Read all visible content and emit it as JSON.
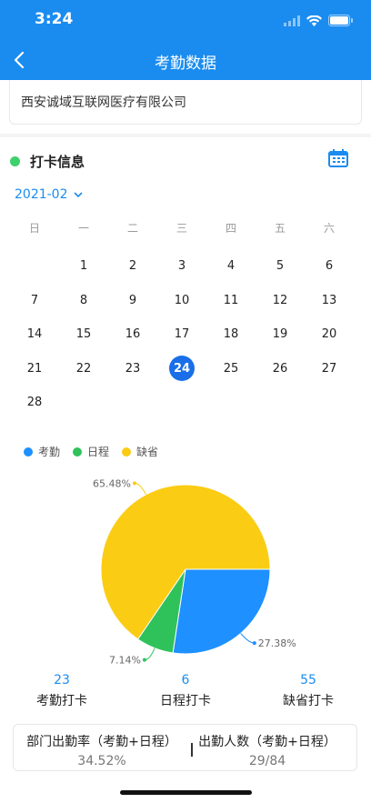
{
  "status_bar": {
    "time": "3:24"
  },
  "nav": {
    "title": "考勤数据"
  },
  "company": {
    "name": "西安诚域互联网医疗有限公司"
  },
  "section": {
    "title": "打卡信息"
  },
  "calendar": {
    "month": "2021-02",
    "weekdays": [
      "日",
      "一",
      "二",
      "三",
      "四",
      "五",
      "六"
    ],
    "first_weekday": 1,
    "days": [
      "1",
      "2",
      "3",
      "4",
      "5",
      "6",
      "7",
      "8",
      "9",
      "10",
      "11",
      "12",
      "13",
      "14",
      "15",
      "16",
      "17",
      "18",
      "19",
      "20",
      "21",
      "22",
      "23",
      "24",
      "25",
      "26",
      "27",
      "28"
    ],
    "selected_day": "24"
  },
  "chart_data": {
    "type": "pie",
    "legend": [
      {
        "name": "考勤",
        "color": "#1e90ff"
      },
      {
        "name": "日程",
        "color": "#2fc25b"
      },
      {
        "name": "缺省",
        "color": "#facc14"
      }
    ],
    "slices": [
      {
        "name": "考勤",
        "value": 27.38,
        "label": "27.38%",
        "color": "#1e90ff"
      },
      {
        "name": "日程",
        "value": 7.14,
        "label": "7.14%",
        "color": "#2fc25b"
      },
      {
        "name": "缺省",
        "value": 65.48,
        "label": "65.48%",
        "color": "#facc14"
      }
    ]
  },
  "stats": [
    {
      "value": "23",
      "label": "考勤打卡"
    },
    {
      "value": "6",
      "label": "日程打卡"
    },
    {
      "value": "55",
      "label": "缺省打卡"
    }
  ],
  "summary": {
    "rate_label": "部门出勤率（考勤+日程）",
    "rate_value": "34.52%",
    "count_label": "出勤人数（考勤+日程）",
    "count_value": "29/84"
  }
}
